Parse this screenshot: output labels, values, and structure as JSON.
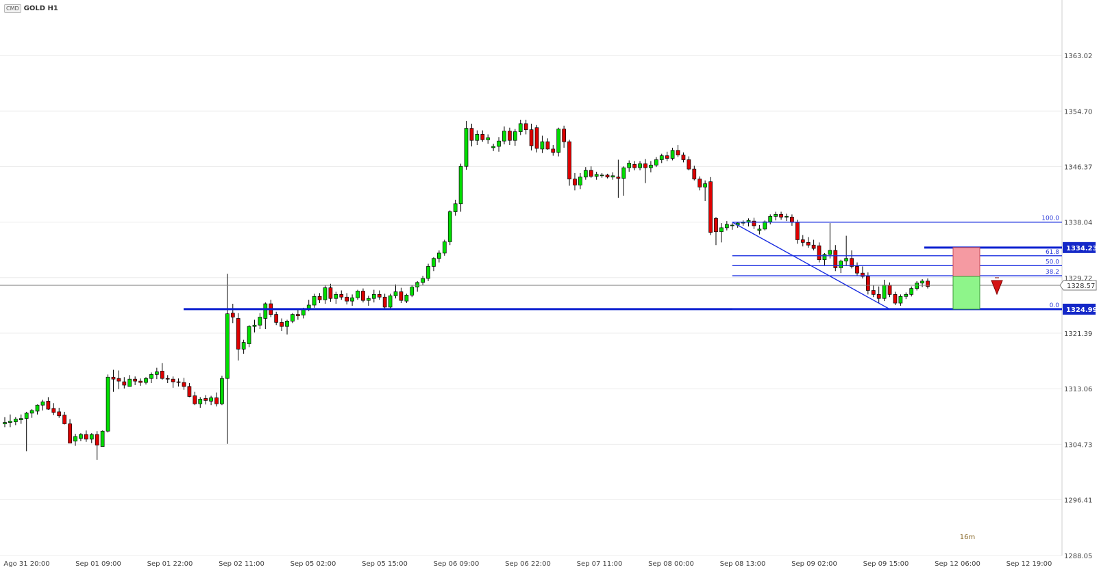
{
  "header": {
    "badge": "CMD",
    "symbol": "GOLD H1"
  },
  "timer": "16m",
  "chart_data": {
    "type": "candlestick",
    "title": "GOLD H1",
    "ylim": [
      1288.05,
      1371.35
    ],
    "y_ticks": [
      "1363.02",
      "1354.70",
      "1346.37",
      "1338.04",
      "1329.72",
      "1321.39",
      "1313.06",
      "1304.73",
      "1296.41",
      "1288.05"
    ],
    "x_ticks": [
      "Ago 31 20:00",
      "Sep 01 09:00",
      "Sep 01 22:00",
      "Sep 02 11:00",
      "Sep 05 02:00",
      "Sep 05 15:00",
      "Sep 06 09:00",
      "Sep 06 22:00",
      "Sep 07 11:00",
      "Sep 08 00:00",
      "Sep 08 13:00",
      "Sep 09 02:00",
      "Sep 09 15:00",
      "Sep 12 06:00",
      "Sep 12 19:00"
    ],
    "grid": true,
    "current_price": "1328.57",
    "support_level": {
      "price": 1324.99,
      "label": "1324.99"
    },
    "target_level": {
      "price": 1334.23,
      "label": "1334.23"
    },
    "fibonacci": {
      "from_price": 1338.04,
      "to_price": 1324.99,
      "levels": [
        {
          "ratio": "100.0",
          "price": 1338.04
        },
        {
          "ratio": "61.8",
          "price": 1333.0
        },
        {
          "ratio": "50.0",
          "price": 1331.51
        },
        {
          "ratio": "38.2",
          "price": 1330.0
        },
        {
          "ratio": "0.0",
          "price": 1324.99
        }
      ]
    },
    "trade_zone": {
      "stop_price": 1334.23,
      "entry_price": 1329.9,
      "target_price": 1324.99,
      "direction": "sell"
    },
    "candles": [
      [
        1307.8,
        1308.8,
        1307.3,
        1308.0
      ],
      [
        1308.0,
        1309.2,
        1307.3,
        1308.2
      ],
      [
        1308.1,
        1308.8,
        1307.6,
        1308.5
      ],
      [
        1308.4,
        1309.2,
        1307.8,
        1308.6
      ],
      [
        1308.6,
        1309.6,
        1303.7,
        1309.4
      ],
      [
        1309.4,
        1310.0,
        1308.7,
        1309.8
      ],
      [
        1309.7,
        1310.7,
        1309.2,
        1310.6
      ],
      [
        1310.6,
        1311.4,
        1309.8,
        1311.1
      ],
      [
        1311.2,
        1311.8,
        1309.9,
        1310.0
      ],
      [
        1310.1,
        1310.9,
        1309.1,
        1309.5
      ],
      [
        1309.6,
        1310.2,
        1308.7,
        1309.0
      ],
      [
        1309.1,
        1309.6,
        1307.7,
        1307.8
      ],
      [
        1307.8,
        1308.5,
        1304.9,
        1304.9
      ],
      [
        1305.2,
        1306.3,
        1304.5,
        1305.9
      ],
      [
        1305.6,
        1306.4,
        1305.2,
        1306.2
      ],
      [
        1306.2,
        1306.8,
        1305.1,
        1305.5
      ],
      [
        1305.5,
        1306.4,
        1304.9,
        1306.2
      ],
      [
        1306.2,
        1306.7,
        1302.4,
        1304.6
      ],
      [
        1304.4,
        1306.8,
        1304.4,
        1306.7
      ],
      [
        1306.7,
        1315.2,
        1306.5,
        1314.8
      ],
      [
        1314.8,
        1315.9,
        1312.6,
        1314.5
      ],
      [
        1314.6,
        1315.8,
        1313.0,
        1314.2
      ],
      [
        1314.1,
        1314.8,
        1313.1,
        1313.6
      ],
      [
        1313.4,
        1315.1,
        1313.4,
        1314.5
      ],
      [
        1314.5,
        1314.9,
        1313.6,
        1314.2
      ],
      [
        1314.2,
        1314.6,
        1313.5,
        1314.0
      ],
      [
        1314.0,
        1314.8,
        1313.7,
        1314.6
      ],
      [
        1314.6,
        1315.5,
        1313.9,
        1315.2
      ],
      [
        1315.2,
        1316.2,
        1314.5,
        1315.6
      ],
      [
        1315.7,
        1316.9,
        1314.4,
        1314.6
      ],
      [
        1314.6,
        1315.1,
        1313.9,
        1314.5
      ],
      [
        1314.5,
        1314.9,
        1313.2,
        1314.1
      ],
      [
        1314.1,
        1314.6,
        1313.4,
        1314.0
      ],
      [
        1314.0,
        1314.7,
        1312.9,
        1313.4
      ],
      [
        1313.4,
        1313.9,
        1311.8,
        1311.9
      ],
      [
        1312.0,
        1312.6,
        1310.6,
        1310.8
      ],
      [
        1310.8,
        1311.8,
        1310.2,
        1311.5
      ],
      [
        1311.6,
        1312.1,
        1310.7,
        1311.3
      ],
      [
        1311.2,
        1312.0,
        1310.6,
        1311.7
      ],
      [
        1311.7,
        1312.5,
        1310.4,
        1310.8
      ],
      [
        1310.8,
        1315.0,
        1310.6,
        1314.6
      ],
      [
        1314.6,
        1330.3,
        1304.8,
        1324.3
      ],
      [
        1324.4,
        1325.8,
        1322.9,
        1323.8
      ],
      [
        1323.6,
        1324.4,
        1317.3,
        1319.0
      ],
      [
        1319.0,
        1320.4,
        1318.3,
        1320.0
      ],
      [
        1319.8,
        1322.6,
        1319.3,
        1322.4
      ],
      [
        1322.4,
        1323.4,
        1321.5,
        1322.6
      ],
      [
        1322.6,
        1324.4,
        1322.0,
        1323.8
      ],
      [
        1323.6,
        1326.0,
        1322.0,
        1325.8
      ],
      [
        1325.8,
        1326.4,
        1323.8,
        1324.2
      ],
      [
        1324.2,
        1324.6,
        1322.6,
        1323.0
      ],
      [
        1323.0,
        1323.6,
        1321.7,
        1322.4
      ],
      [
        1322.4,
        1323.4,
        1321.2,
        1323.2
      ],
      [
        1323.2,
        1324.4,
        1322.9,
        1324.2
      ],
      [
        1324.2,
        1324.9,
        1323.4,
        1324.0
      ],
      [
        1324.1,
        1325.2,
        1323.6,
        1325.0
      ],
      [
        1325.0,
        1326.4,
        1324.7,
        1325.6
      ],
      [
        1325.6,
        1327.3,
        1325.2,
        1326.9
      ],
      [
        1326.9,
        1327.4,
        1325.9,
        1326.4
      ],
      [
        1326.4,
        1328.6,
        1325.8,
        1328.2
      ],
      [
        1328.2,
        1328.8,
        1326.1,
        1326.6
      ],
      [
        1326.6,
        1327.6,
        1325.8,
        1327.2
      ],
      [
        1327.2,
        1327.8,
        1326.4,
        1326.8
      ],
      [
        1326.8,
        1327.4,
        1325.7,
        1326.2
      ],
      [
        1326.2,
        1327.2,
        1325.5,
        1326.7
      ],
      [
        1326.7,
        1327.9,
        1326.4,
        1327.7
      ],
      [
        1327.7,
        1328.1,
        1326.0,
        1326.3
      ],
      [
        1326.3,
        1327.0,
        1325.5,
        1326.6
      ],
      [
        1326.6,
        1327.9,
        1326.0,
        1327.2
      ],
      [
        1327.2,
        1327.8,
        1326.4,
        1326.8
      ],
      [
        1326.8,
        1327.3,
        1325.0,
        1325.3
      ],
      [
        1325.3,
        1327.3,
        1325.0,
        1327.0
      ],
      [
        1327.0,
        1328.7,
        1326.6,
        1327.6
      ],
      [
        1327.6,
        1328.2,
        1325.9,
        1326.3
      ],
      [
        1326.2,
        1327.3,
        1325.9,
        1327.1
      ],
      [
        1327.1,
        1328.6,
        1326.8,
        1328.3
      ],
      [
        1328.3,
        1329.2,
        1327.6,
        1329.0
      ],
      [
        1329.0,
        1330.0,
        1328.6,
        1329.6
      ],
      [
        1329.6,
        1331.8,
        1329.2,
        1331.4
      ],
      [
        1331.4,
        1332.8,
        1330.7,
        1332.6
      ],
      [
        1332.6,
        1333.8,
        1332.0,
        1333.4
      ],
      [
        1333.4,
        1335.4,
        1333.0,
        1335.1
      ],
      [
        1335.1,
        1339.8,
        1334.6,
        1339.6
      ],
      [
        1339.6,
        1341.4,
        1339.0,
        1340.8
      ],
      [
        1340.8,
        1346.8,
        1339.6,
        1346.4
      ],
      [
        1346.4,
        1353.2,
        1345.9,
        1352.1
      ],
      [
        1352.1,
        1352.8,
        1349.4,
        1350.3
      ],
      [
        1350.3,
        1351.8,
        1349.6,
        1351.2
      ],
      [
        1351.2,
        1351.8,
        1350.1,
        1350.4
      ],
      [
        1350.4,
        1351.2,
        1349.8,
        1350.7
      ],
      [
        1349.2,
        1349.8,
        1348.7,
        1349.4
      ],
      [
        1349.4,
        1350.8,
        1348.6,
        1350.2
      ],
      [
        1350.2,
        1352.4,
        1349.7,
        1351.7
      ],
      [
        1351.7,
        1352.2,
        1349.6,
        1350.3
      ],
      [
        1350.3,
        1352.0,
        1349.5,
        1351.6
      ],
      [
        1351.6,
        1353.4,
        1351.1,
        1352.8
      ],
      [
        1352.8,
        1353.4,
        1351.2,
        1351.9
      ],
      [
        1351.9,
        1352.8,
        1348.8,
        1349.5
      ],
      [
        1352.2,
        1352.6,
        1348.5,
        1349.1
      ],
      [
        1349.0,
        1351.0,
        1348.4,
        1350.1
      ],
      [
        1350.1,
        1350.6,
        1348.9,
        1349.0
      ],
      [
        1349.0,
        1349.6,
        1348.0,
        1348.5
      ],
      [
        1348.5,
        1352.2,
        1347.9,
        1352.0
      ],
      [
        1352.0,
        1352.5,
        1349.2,
        1350.1
      ],
      [
        1350.1,
        1350.4,
        1343.5,
        1344.5
      ],
      [
        1344.5,
        1345.4,
        1342.8,
        1343.6
      ],
      [
        1343.6,
        1345.4,
        1343.0,
        1344.8
      ],
      [
        1344.8,
        1346.3,
        1344.4,
        1345.8
      ],
      [
        1345.8,
        1346.4,
        1344.7,
        1344.9
      ],
      [
        1344.9,
        1345.6,
        1344.4,
        1345.2
      ],
      [
        1345.0,
        1345.4,
        1344.7,
        1345.1
      ],
      [
        1345.1,
        1345.3,
        1344.6,
        1344.8
      ],
      [
        1344.8,
        1345.5,
        1344.4,
        1345.0
      ],
      [
        1344.8,
        1347.4,
        1341.7,
        1344.6
      ],
      [
        1344.6,
        1346.4,
        1342.0,
        1346.2
      ],
      [
        1346.2,
        1347.3,
        1345.6,
        1346.9
      ],
      [
        1346.7,
        1347.2,
        1345.8,
        1346.2
      ],
      [
        1346.2,
        1347.2,
        1345.8,
        1346.8
      ],
      [
        1346.8,
        1347.5,
        1343.9,
        1346.2
      ],
      [
        1346.2,
        1347.2,
        1345.5,
        1346.6
      ],
      [
        1346.6,
        1347.8,
        1346.3,
        1347.4
      ],
      [
        1347.4,
        1348.3,
        1346.9,
        1348.0
      ],
      [
        1348.0,
        1348.6,
        1347.2,
        1347.6
      ],
      [
        1347.6,
        1349.2,
        1347.3,
        1348.8
      ],
      [
        1348.8,
        1349.6,
        1347.8,
        1348.1
      ],
      [
        1348.1,
        1348.5,
        1347.0,
        1347.4
      ],
      [
        1347.4,
        1347.9,
        1345.8,
        1346.0
      ],
      [
        1346.0,
        1346.5,
        1344.3,
        1344.5
      ],
      [
        1344.5,
        1344.9,
        1342.8,
        1343.3
      ],
      [
        1343.3,
        1344.3,
        1341.2,
        1343.8
      ],
      [
        1344.1,
        1344.8,
        1336.1,
        1336.5
      ],
      [
        1338.6,
        1338.8,
        1334.6,
        1336.6
      ],
      [
        1336.6,
        1337.9,
        1335.0,
        1337.2
      ],
      [
        1337.2,
        1338.2,
        1336.8,
        1337.7
      ],
      [
        1337.5,
        1337.9,
        1336.9,
        1337.6
      ],
      [
        1337.6,
        1338.0,
        1337.2,
        1337.9
      ],
      [
        1337.9,
        1338.3,
        1337.5,
        1338.0
      ],
      [
        1338.0,
        1338.6,
        1337.4,
        1338.3
      ],
      [
        1338.2,
        1338.7,
        1337.0,
        1337.5
      ],
      [
        1336.8,
        1337.6,
        1336.2,
        1337.0
      ],
      [
        1337.0,
        1338.3,
        1336.8,
        1338.1
      ],
      [
        1338.1,
        1339.2,
        1337.7,
        1338.9
      ],
      [
        1338.9,
        1339.6,
        1338.3,
        1339.2
      ],
      [
        1339.2,
        1339.6,
        1338.4,
        1338.8
      ],
      [
        1338.8,
        1339.3,
        1338.2,
        1338.9
      ],
      [
        1338.8,
        1339.2,
        1337.5,
        1338.0
      ],
      [
        1338.0,
        1338.4,
        1334.8,
        1335.4
      ],
      [
        1335.4,
        1336.1,
        1334.4,
        1335.0
      ],
      [
        1335.0,
        1335.8,
        1334.2,
        1334.6
      ],
      [
        1334.6,
        1335.4,
        1333.8,
        1334.1
      ],
      [
        1334.5,
        1335.0,
        1332.0,
        1332.4
      ],
      [
        1332.4,
        1333.4,
        1331.6,
        1333.2
      ],
      [
        1333.2,
        1337.9,
        1332.6,
        1333.8
      ],
      [
        1333.8,
        1334.6,
        1330.7,
        1331.2
      ],
      [
        1331.2,
        1332.4,
        1330.4,
        1332.2
      ],
      [
        1332.2,
        1336.0,
        1331.6,
        1332.6
      ],
      [
        1332.6,
        1333.8,
        1331.1,
        1331.4
      ],
      [
        1331.4,
        1332.0,
        1330.0,
        1330.4
      ],
      [
        1330.4,
        1331.4,
        1329.6,
        1329.9
      ],
      [
        1329.9,
        1330.5,
        1327.2,
        1327.8
      ],
      [
        1327.8,
        1328.6,
        1326.8,
        1327.2
      ],
      [
        1327.2,
        1328.4,
        1325.9,
        1326.6
      ],
      [
        1326.6,
        1329.4,
        1326.2,
        1328.6
      ],
      [
        1328.6,
        1329.0,
        1326.8,
        1327.2
      ],
      [
        1327.2,
        1327.6,
        1325.6,
        1325.9
      ],
      [
        1325.9,
        1327.2,
        1325.5,
        1326.9
      ],
      [
        1326.9,
        1327.5,
        1326.5,
        1327.2
      ],
      [
        1327.2,
        1328.4,
        1326.9,
        1328.1
      ],
      [
        1328.1,
        1329.2,
        1327.8,
        1328.9
      ],
      [
        1328.9,
        1329.5,
        1328.3,
        1329.2
      ],
      [
        1329.2,
        1329.6,
        1328.1,
        1328.4
      ]
    ]
  }
}
